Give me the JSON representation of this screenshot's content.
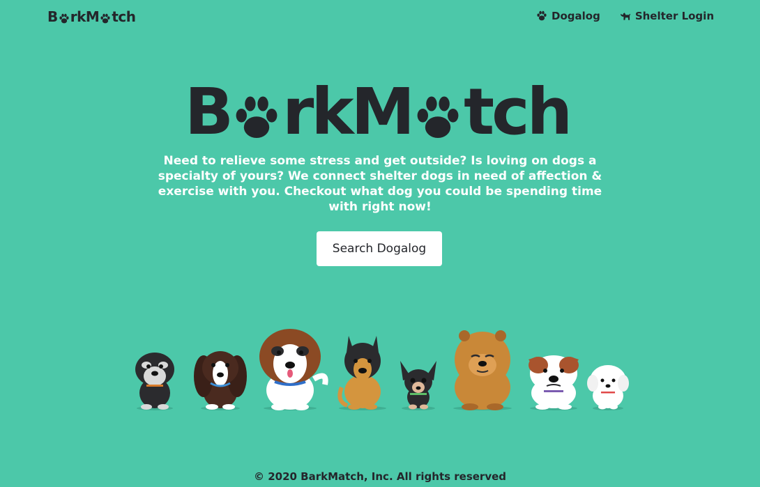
{
  "nav": {
    "logo": {
      "prefix": "B",
      "middle": "rkM",
      "suffix": "tch",
      "alt": "BarkMatch"
    },
    "links": [
      {
        "label": "Dogalog",
        "icon": "paw-icon"
      },
      {
        "label": "Shelter Login",
        "icon": "dog-icon"
      }
    ]
  },
  "hero": {
    "logo": {
      "prefix": "B",
      "middle": "rkM",
      "suffix": "tch"
    },
    "tagline": "Need to relieve some stress and get outside? Is loving on dogs a specialty of yours? We connect shelter dogs in need of affection & exercise with you. Checkout what dog you could be spending time with right now!",
    "cta_label": "Search Dogalog"
  },
  "illustration": {
    "dogs": [
      "schnauzer",
      "spaniel",
      "saint-bernard",
      "german-shepherd",
      "chihuahua",
      "chow-chow",
      "bulldog",
      "bichon"
    ]
  },
  "footer": {
    "text": "© 2020 BarkMatch, Inc. All rights reserved"
  },
  "colors": {
    "background": "#4CC8A9",
    "ink": "#24262B",
    "white": "#FFFFFF"
  }
}
